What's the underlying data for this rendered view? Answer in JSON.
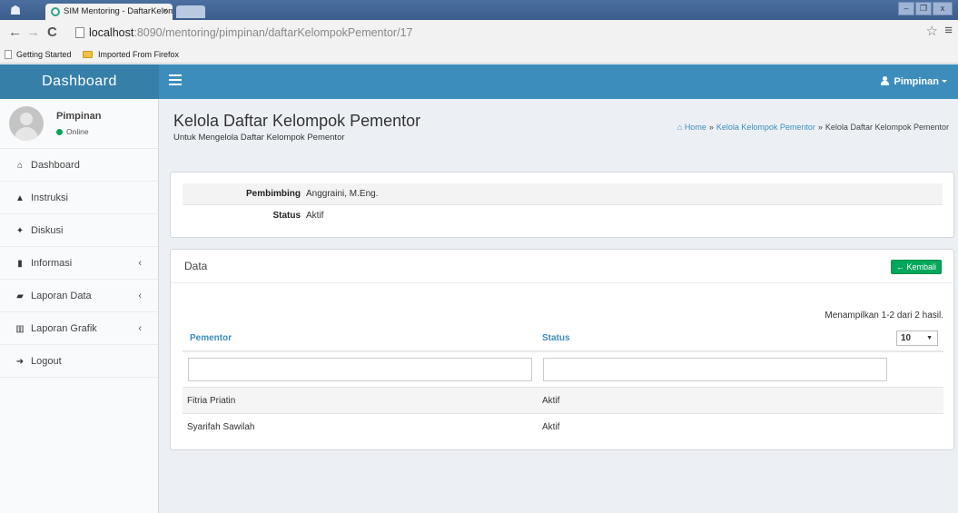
{
  "browser": {
    "tab_title": "SIM Mentoring - DaftarKelom",
    "tab_close": "×",
    "url_host": "localhost",
    "url_path": ":8090/mentoring/pimpinan/daftarKelompokPementor/17",
    "bookmarks": [
      "Getting Started",
      "Imported From Firefox"
    ]
  },
  "header": {
    "logo": "Dashboard",
    "user_label": "Pimpinan"
  },
  "sidebar": {
    "user_name": "Pimpinan",
    "user_status": "Online",
    "items": [
      {
        "label": "Dashboard",
        "icon": "home-icon",
        "glyph": "⌂",
        "chevron": ""
      },
      {
        "label": "Instruksi",
        "icon": "warning-icon",
        "glyph": "▲",
        "chevron": ""
      },
      {
        "label": "Diskusi",
        "icon": "users-icon",
        "glyph": "✦",
        "chevron": ""
      },
      {
        "label": "Informasi",
        "icon": "file-icon",
        "glyph": "▮",
        "chevron": "‹"
      },
      {
        "label": "Laporan Data",
        "icon": "book-icon",
        "glyph": "▰",
        "chevron": "‹"
      },
      {
        "label": "Laporan Grafik",
        "icon": "bar-chart-icon",
        "glyph": "▥",
        "chevron": "‹"
      },
      {
        "label": "Logout",
        "icon": "sign-out-icon",
        "glyph": "➜",
        "chevron": ""
      }
    ]
  },
  "content": {
    "title": "Kelola Daftar Kelompok Pementor",
    "subtitle": "Untuk Mengelola Daftar Kelompok Pementor",
    "breadcrumb": {
      "home": "Home",
      "level1": "Kelola Kelompok Pementor",
      "current": "Kelola Daftar Kelompok Pementor"
    }
  },
  "info": {
    "pembimbing_label": "Pembimbing",
    "pembimbing_value": "Anggraini, M.Eng.",
    "status_label": "Status",
    "status_value": "Aktif"
  },
  "data_box": {
    "title": "Data",
    "back_button": "Kembali",
    "summary": "Menampilkan 1-2 dari 2 hasil.",
    "page_size": "10",
    "columns": [
      "Pementor",
      "Status"
    ],
    "rows": [
      [
        "Fitria Priatin",
        "Aktif"
      ],
      [
        "Syarifah Sawilah",
        "Aktif"
      ]
    ]
  },
  "colors": {
    "header_blue": "#3c8dbc",
    "logo_blue": "#367fa9",
    "success_green": "#00a65a",
    "content_bg": "#ecf0f5"
  }
}
